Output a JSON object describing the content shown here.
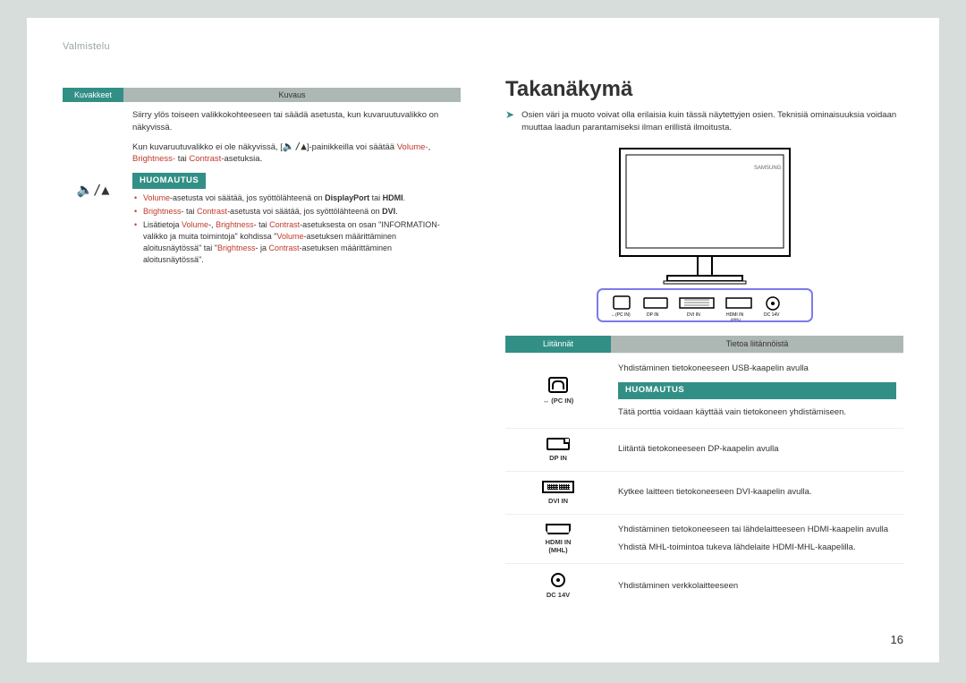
{
  "header": {
    "section": "Valmistelu"
  },
  "page_number": "16",
  "left_table": {
    "columns": {
      "icons": "Kuvakkeet",
      "description": "Kuvaus"
    },
    "row": {
      "icon_name": "volume-up-icon",
      "para1": "Siirry ylös toiseen valikkokohteeseen tai säädä asetusta, kun kuvaruutuvalikko on näkyvissä.",
      "para2_pre": "Kun kuvaruutuvalikko ei ole näkyvissä, [",
      "para2_post": "]-painikkeilla voi säätää ",
      "vbc": {
        "volume": "Volume-",
        "brightness": "Brightness-",
        "contrast": "Contrast",
        "tail": "-asetuksia.",
        "sep": ", ",
        "or": " tai "
      },
      "note_label": "HUOMAUTUS",
      "bullets": [
        {
          "pre": "",
          "red1": "Volume",
          "mid1": "-asetusta voi säätää, jos syöttölähteenä on ",
          "bold1": "DisplayPort",
          "mid2": " tai ",
          "bold2": "HDMI",
          "post": "."
        },
        {
          "red1": "Brightness",
          "mid1": "- tai ",
          "red2": "Contrast",
          "mid2": "-asetusta voi säätää, jos syöttölähteenä on ",
          "bold1": "DVI",
          "post": "."
        },
        {
          "pre": "Lisätietoja ",
          "red1": "Volume",
          "mid1": "-, ",
          "red2": "Brightness",
          "mid2": "- tai ",
          "red3": "Contrast",
          "mid3": "-asetuksesta on osan \"INFORMATION-valikko ja muita toimintoja\" kohdissa \"",
          "red4": "Volume",
          "mid4": "-asetuksen määrittäminen aloitusnäytössä\" tai \"",
          "red5": "Brightness",
          "mid5": "- ja ",
          "red6": "Contrast",
          "mid6": "-asetuksen määrittäminen aloitusnäytössä\"."
        }
      ]
    }
  },
  "right": {
    "title": "Takanäkymä",
    "intro": "Osien väri ja muoto voivat olla erilaisia kuin tässä näytettyjen osien. Teknisiä ominaisuuksia voidaan muuttaa laadun parantamiseksi ilman erillistä ilmoitusta.",
    "table": {
      "columns": {
        "ports": "Liitännät",
        "desc": "Tietoa liitännöistä"
      },
      "rows": [
        {
          "icon": "usb-b",
          "label": "↔ (PC IN)",
          "text": "Yhdistäminen tietokoneeseen USB-kaapelin avulla",
          "note_label": "HUOMAUTUS",
          "note_text": "Tätä porttia voidaan käyttää vain tietokoneen yhdistämiseen."
        },
        {
          "icon": "dp",
          "label": "DP IN",
          "text": "Liitäntä tietokoneeseen DP-kaapelin avulla"
        },
        {
          "icon": "dvi",
          "label": "DVI IN",
          "text": "Kytkee laitteen tietokoneeseen DVI-kaapelin avulla."
        },
        {
          "icon": "hdmi",
          "label": "HDMI IN\n(MHL)",
          "text": "Yhdistäminen tietokoneeseen tai lähdelaitteeseen HDMI-kaapelin avulla",
          "text2": "Yhdistä MHL-toimintoa tukeva lähdelaite HDMI-MHL-kaapelilla."
        },
        {
          "icon": "dc",
          "label": "DC 14V",
          "text": "Yhdistäminen verkkolaitteeseen"
        }
      ]
    }
  }
}
